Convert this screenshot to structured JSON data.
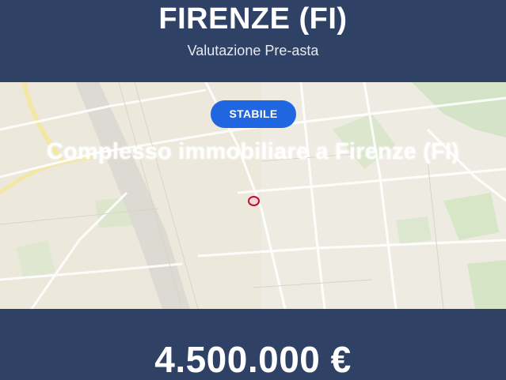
{
  "header": {
    "title": "FIRENZE (FI)",
    "subtitle": "Valutazione Pre-asta"
  },
  "map": {
    "status_badge": "STABILE",
    "overlay_title": "Complesso immobiliare a Firenze (FI)",
    "pin_icon": "map-pin-icon"
  },
  "footer": {
    "price": "4.500.000 €"
  },
  "colors": {
    "header_bg": "#2f4266",
    "badge_bg": "#1f66e0",
    "pin": "#c20e2a",
    "map_bg": "#ede9dc"
  }
}
